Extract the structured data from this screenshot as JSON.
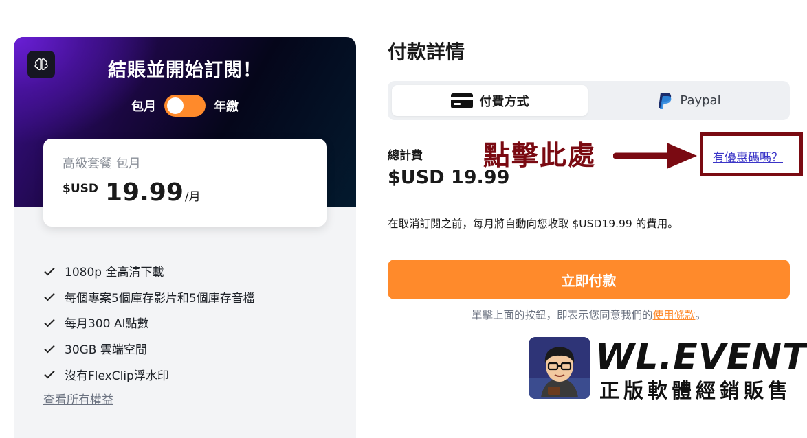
{
  "left_panel": {
    "hero_title": "結賬並開始訂閱！",
    "billing_toggle": {
      "left_label": "包月",
      "right_label": "年繳"
    },
    "plan": {
      "name": "高級套餐 包月",
      "currency": "$USD",
      "amount": "19.99",
      "unit": "/月"
    },
    "features": [
      "1080p 全高清下載",
      "每個專案5個庫存影片和5個庫存音檔",
      "每月300 AI點數",
      "30GB 雲端空間",
      "沒有FlexClip浮水印"
    ],
    "view_all": "查看所有權益"
  },
  "right_panel": {
    "title": "付款詳情",
    "tabs": [
      {
        "label": "付費方式",
        "icon": "credit-card-icon",
        "selected": true
      },
      {
        "label": "Paypal",
        "icon": "paypal-icon",
        "selected": false
      }
    ],
    "total_label": "總計費",
    "total_amount": "$USD 19.99",
    "coupon_link": "有優惠碼嗎？",
    "annotation": "點擊此處",
    "auto_renew_note": "在取消訂閱之前，每月將自動向您收取 $USD19.99 的費用。",
    "pay_button": "立即付款",
    "terms_prefix": "單擊上面的按鈕，即表示您同意我們的",
    "terms_link": "使用條款",
    "terms_suffix": "。"
  },
  "watermark": {
    "brand": "WL.EVENT",
    "tagline": "正版軟體經銷販售"
  },
  "colors": {
    "accent": "#ff8a2b",
    "annotation": "#7a0a12",
    "link": "#3b35c7"
  }
}
